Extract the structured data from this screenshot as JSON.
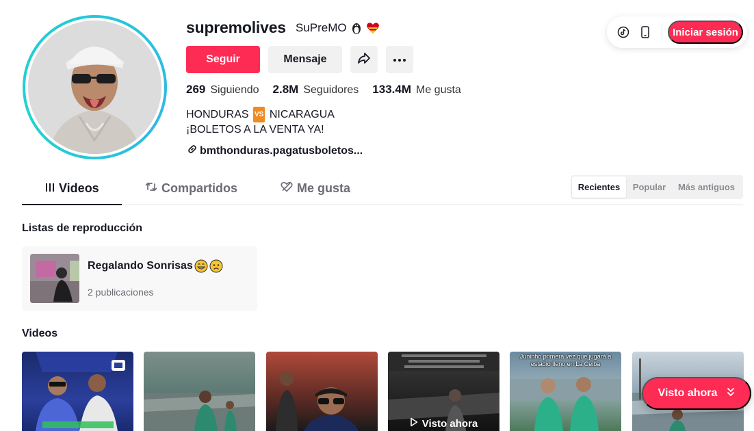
{
  "profile": {
    "username": "supremolives",
    "nickname": "SuPreMO",
    "nickname_emojis": [
      "penguin-emoji",
      "heart-emoji"
    ],
    "follow_label": "Seguir",
    "message_label": "Mensaje",
    "stats": [
      {
        "value": "269",
        "label": "Siguiendo"
      },
      {
        "value": "2.8M",
        "label": "Seguidores"
      },
      {
        "value": "133.4M",
        "label": "Me gusta"
      }
    ],
    "bio_line1_left": "HONDURAS",
    "bio_vs": "VS",
    "bio_line1_right": "NICARAGUA",
    "bio_line2": "¡BOLETOS A LA VENTA YA!",
    "link_text": "bmthonduras.pagatusboletos..."
  },
  "top_actions": {
    "login_label": "Iniciar sesión",
    "icons": [
      "tiktok-icon",
      "mobile-icon"
    ]
  },
  "tabs": [
    {
      "label": "Videos",
      "icon": "grid-icon",
      "active": true
    },
    {
      "label": "Compartidos",
      "icon": "repost-icon",
      "active": false
    },
    {
      "label": "Me gusta",
      "icon": "heart-outline-icon",
      "active": false
    }
  ],
  "sort": [
    {
      "label": "Recientes",
      "active": true
    },
    {
      "label": "Popular",
      "active": false
    },
    {
      "label": "Más antiguos",
      "active": false
    }
  ],
  "playlists": {
    "title": "Listas de reproducción",
    "items": [
      {
        "title": "Regalando Sonrisas",
        "emojis": [
          "grin-emoji",
          "sad-emoji"
        ],
        "count": "2 publicaciones"
      }
    ]
  },
  "videos": {
    "title": "Videos",
    "items": [
      {
        "caption": "",
        "watched": ""
      },
      {
        "caption": "",
        "watched": ""
      },
      {
        "caption": "",
        "watched": ""
      },
      {
        "caption": "",
        "watched": "Visto ahora"
      },
      {
        "caption": "Juninho primera vez que jugará a estadio lleno en La Ceiba",
        "watched": ""
      },
      {
        "caption": "",
        "watched": ""
      }
    ]
  },
  "float_button": {
    "label": "Visto ahora"
  },
  "colors": {
    "brand": "#fe2c55",
    "ring": "#25c7d9",
    "text": "#161823"
  }
}
